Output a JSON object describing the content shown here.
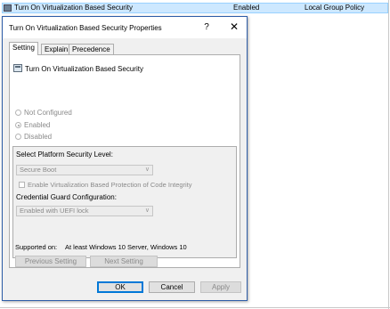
{
  "background_list": {
    "policy_name": "Turn On Virtualization Based Security",
    "state": "Enabled",
    "source": "Local Group Policy"
  },
  "dialog": {
    "title": "Turn On Virtualization Based Security Properties",
    "help_glyph": "?",
    "close_glyph": "✕",
    "tabs": [
      "Setting",
      "Explain",
      "Precedence"
    ],
    "policy_name": "Turn On Virtualization Based Security",
    "radios": {
      "not_configured": "Not Configured",
      "enabled": "Enabled",
      "disabled": "Disabled"
    },
    "options": {
      "platform_label": "Select Platform Security Level:",
      "platform_value": "Secure Boot",
      "code_integrity_label": "Enable Virtualization Based Protection of Code Integrity",
      "credential_label": "Credential Guard Configuration:",
      "credential_value": "Enabled with UEFI lock"
    },
    "supported_label": "Supported on:",
    "supported_value": "At least Windows 10 Server, Windows 10",
    "buttons": {
      "previous": "Previous Setting",
      "next": "Next Setting",
      "ok": "OK",
      "cancel": "Cancel",
      "apply": "Apply"
    }
  },
  "colors": {
    "selection": "#cde8ff",
    "dialog_border": "#2f5ea8",
    "default_button": "#0078d7"
  }
}
